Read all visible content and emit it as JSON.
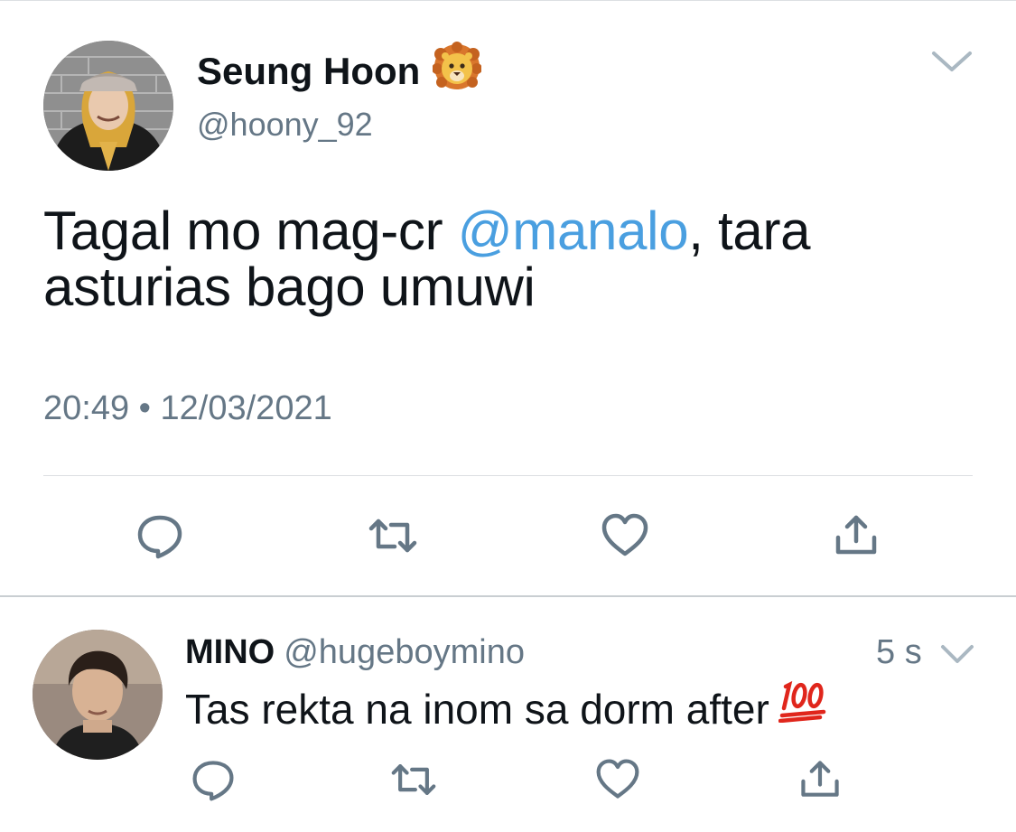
{
  "tweet": {
    "display_name": "Seung Hoon",
    "name_emoji": "lion-face-emoji",
    "handle": "@hoony_92",
    "text_before": "Tagal mo mag-cr ",
    "mention": "@manalo",
    "text_after": ", tara asturias bago umuwi",
    "time": "20:49",
    "separator": "•",
    "date": "12/03/2021",
    "actions": [
      "reply-icon",
      "retweet-icon",
      "like-icon",
      "share-icon"
    ]
  },
  "reply": {
    "display_name": "MINO",
    "handle": "@hugeboymino",
    "age": "5 s",
    "text": "Tas rekta na inom sa dorm after",
    "text_emoji": "hundred-points-emoji",
    "actions": [
      "reply-icon",
      "retweet-icon",
      "like-icon",
      "share-icon"
    ]
  },
  "colors": {
    "text": "#0f1419",
    "secondary": "#657786",
    "mention": "#4a9fe0",
    "icon": "#657786",
    "divider": "#dcdfe2",
    "emoji_red": "#e0261c"
  }
}
